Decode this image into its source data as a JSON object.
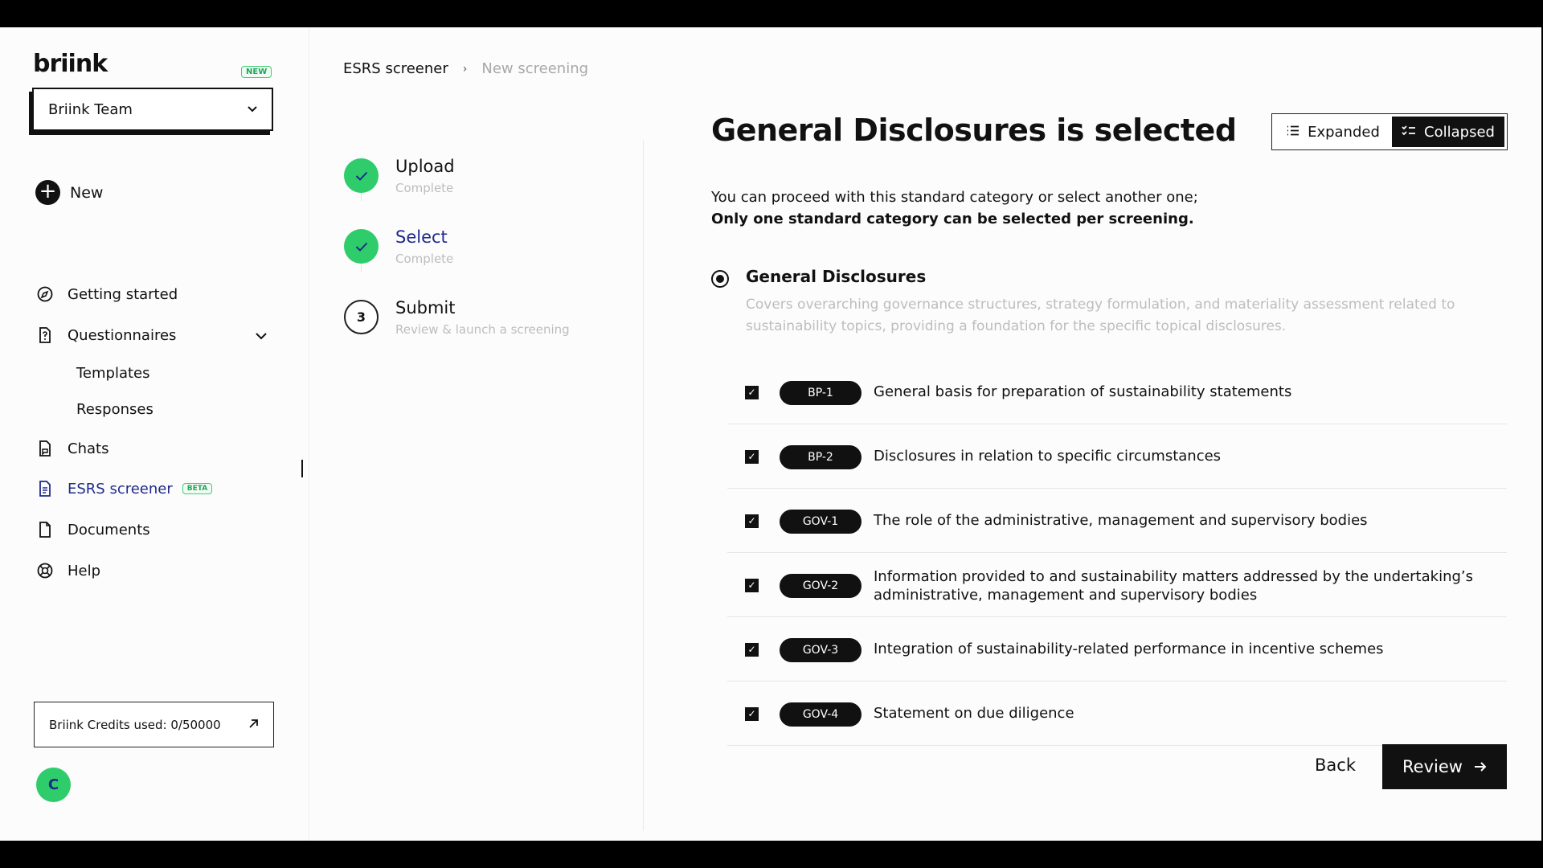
{
  "sidebar": {
    "logo": "briink",
    "logo_badge": "NEW",
    "team": "Briink Team",
    "new_label": "New",
    "nav": {
      "getting_started": "Getting started",
      "questionnaires": "Questionnaires",
      "templates": "Templates",
      "responses": "Responses",
      "chats": "Chats",
      "esrs": "ESRS screener",
      "esrs_badge": "BETA",
      "documents": "Documents",
      "help": "Help"
    },
    "credits": "Briink Credits used: 0/50000",
    "avatar": "C"
  },
  "breadcrumb": {
    "parent": "ESRS screener",
    "current": "New screening"
  },
  "steps": [
    {
      "title": "Upload",
      "sub": "Complete",
      "number": "1"
    },
    {
      "title": "Select",
      "sub": "Complete",
      "number": "2"
    },
    {
      "title": "Submit",
      "sub": "Review & launch a screening",
      "number": "3"
    }
  ],
  "main": {
    "heading": "General Disclosures is selected",
    "view_toggle": {
      "expanded": "Expanded",
      "collapsed": "Collapsed",
      "selected": "Collapsed"
    },
    "intro_line1": "You can proceed with this standard category or select another one;",
    "intro_line2": "Only one standard category can be selected per screening.",
    "category": {
      "title": "General Disclosures",
      "description": "Covers overarching governance structures, strategy formulation, and materiality assessment related to sustainability topics, providing a foundation for the specific topical disclosures."
    },
    "disclosures": [
      {
        "code": "BP-1",
        "text": "General basis for preparation of sustainability statements"
      },
      {
        "code": "BP-2",
        "text": "Disclosures in relation to specific circumstances"
      },
      {
        "code": "GOV-1",
        "text": "The role of the administrative, management and supervisory bodies"
      },
      {
        "code": "GOV-2",
        "text": "Information provided to and sustainability matters addressed by the undertaking’s administrative, management and supervisory bodies"
      },
      {
        "code": "GOV-3",
        "text": "Integration of sustainability-related performance in incentive schemes"
      },
      {
        "code": "GOV-4",
        "text": "Statement on due diligence"
      }
    ],
    "back": "Back",
    "review": "Review"
  },
  "colors": {
    "accent_green": "#2ecc6b",
    "active_nav": "#1f2a8a",
    "dark": "#111111"
  }
}
